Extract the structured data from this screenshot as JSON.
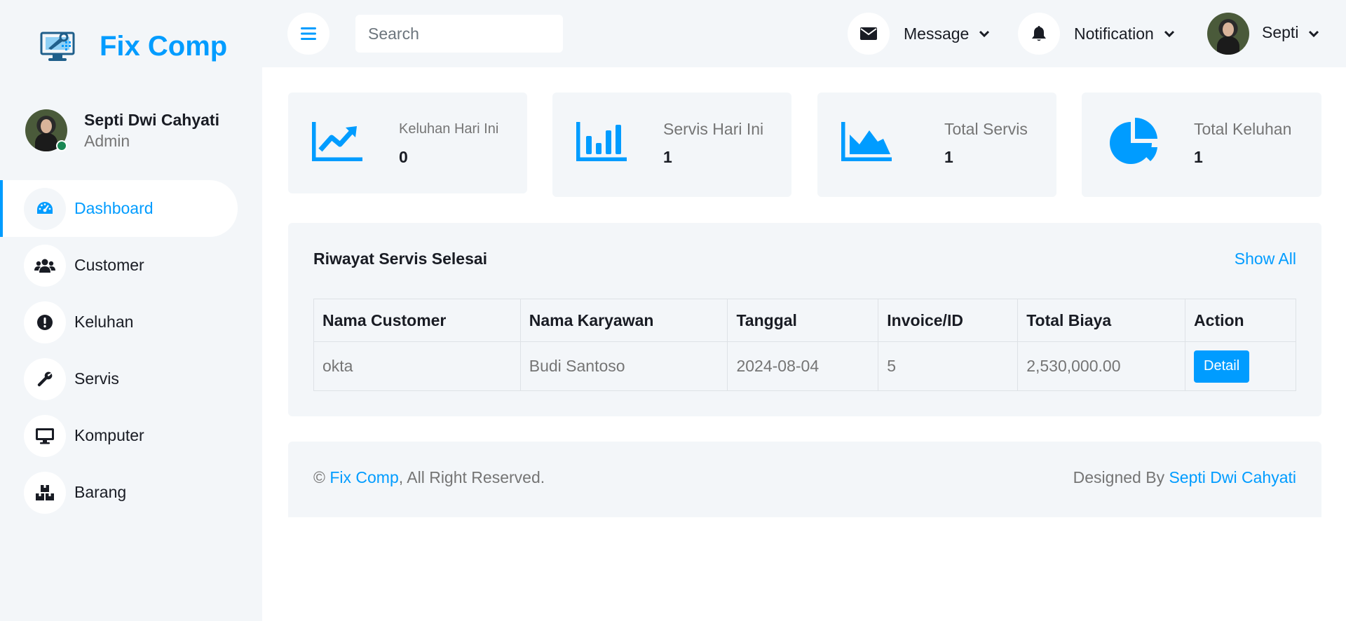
{
  "brand": {
    "name": "Fix Comp",
    "logo_icon": "computer-repair-icon"
  },
  "profile": {
    "name": "Septi Dwi Cahyati",
    "role": "Admin"
  },
  "sidebar": {
    "items": [
      {
        "label": "Dashboard",
        "icon": "tachometer-icon",
        "active": true
      },
      {
        "label": "Customer",
        "icon": "users-icon"
      },
      {
        "label": "Keluhan",
        "icon": "exclamation-icon"
      },
      {
        "label": "Servis",
        "icon": "wrench-icon"
      },
      {
        "label": "Komputer",
        "icon": "desktop-icon"
      },
      {
        "label": "Barang",
        "icon": "boxes-icon"
      }
    ]
  },
  "topbar": {
    "search_placeholder": "Search",
    "message_label": "Message",
    "notification_label": "Notification",
    "user_label": "Septi"
  },
  "stats": [
    {
      "label": "Keluhan Hari Ini",
      "value": "0",
      "icon": "chart-line-icon"
    },
    {
      "label": "Servis Hari Ini",
      "value": "1",
      "icon": "chart-bar-icon"
    },
    {
      "label": "Total Servis",
      "value": "1",
      "icon": "chart-area-icon"
    },
    {
      "label": "Total Keluhan",
      "value": "1",
      "icon": "chart-pie-icon"
    }
  ],
  "history": {
    "title": "Riwayat Servis Selesai",
    "show_all": "Show All",
    "columns": [
      "Nama Customer",
      "Nama Karyawan",
      "Tanggal",
      "Invoice/ID",
      "Total Biaya",
      "Action"
    ],
    "rows": [
      {
        "customer": "okta",
        "employee": "Budi Santoso",
        "date": "2024-08-04",
        "invoice": "5",
        "total": "2,530,000.00",
        "action": "Detail"
      }
    ]
  },
  "footer": {
    "copyright_symbol": "©",
    "brand_link": "Fix Comp",
    "rights": ", All Right Reserved.",
    "designed_by": "Designed By",
    "designer_link": "Septi Dwi Cahyati"
  },
  "colors": {
    "accent": "#009cff",
    "panel": "#f3f6f9",
    "online": "#198754"
  }
}
